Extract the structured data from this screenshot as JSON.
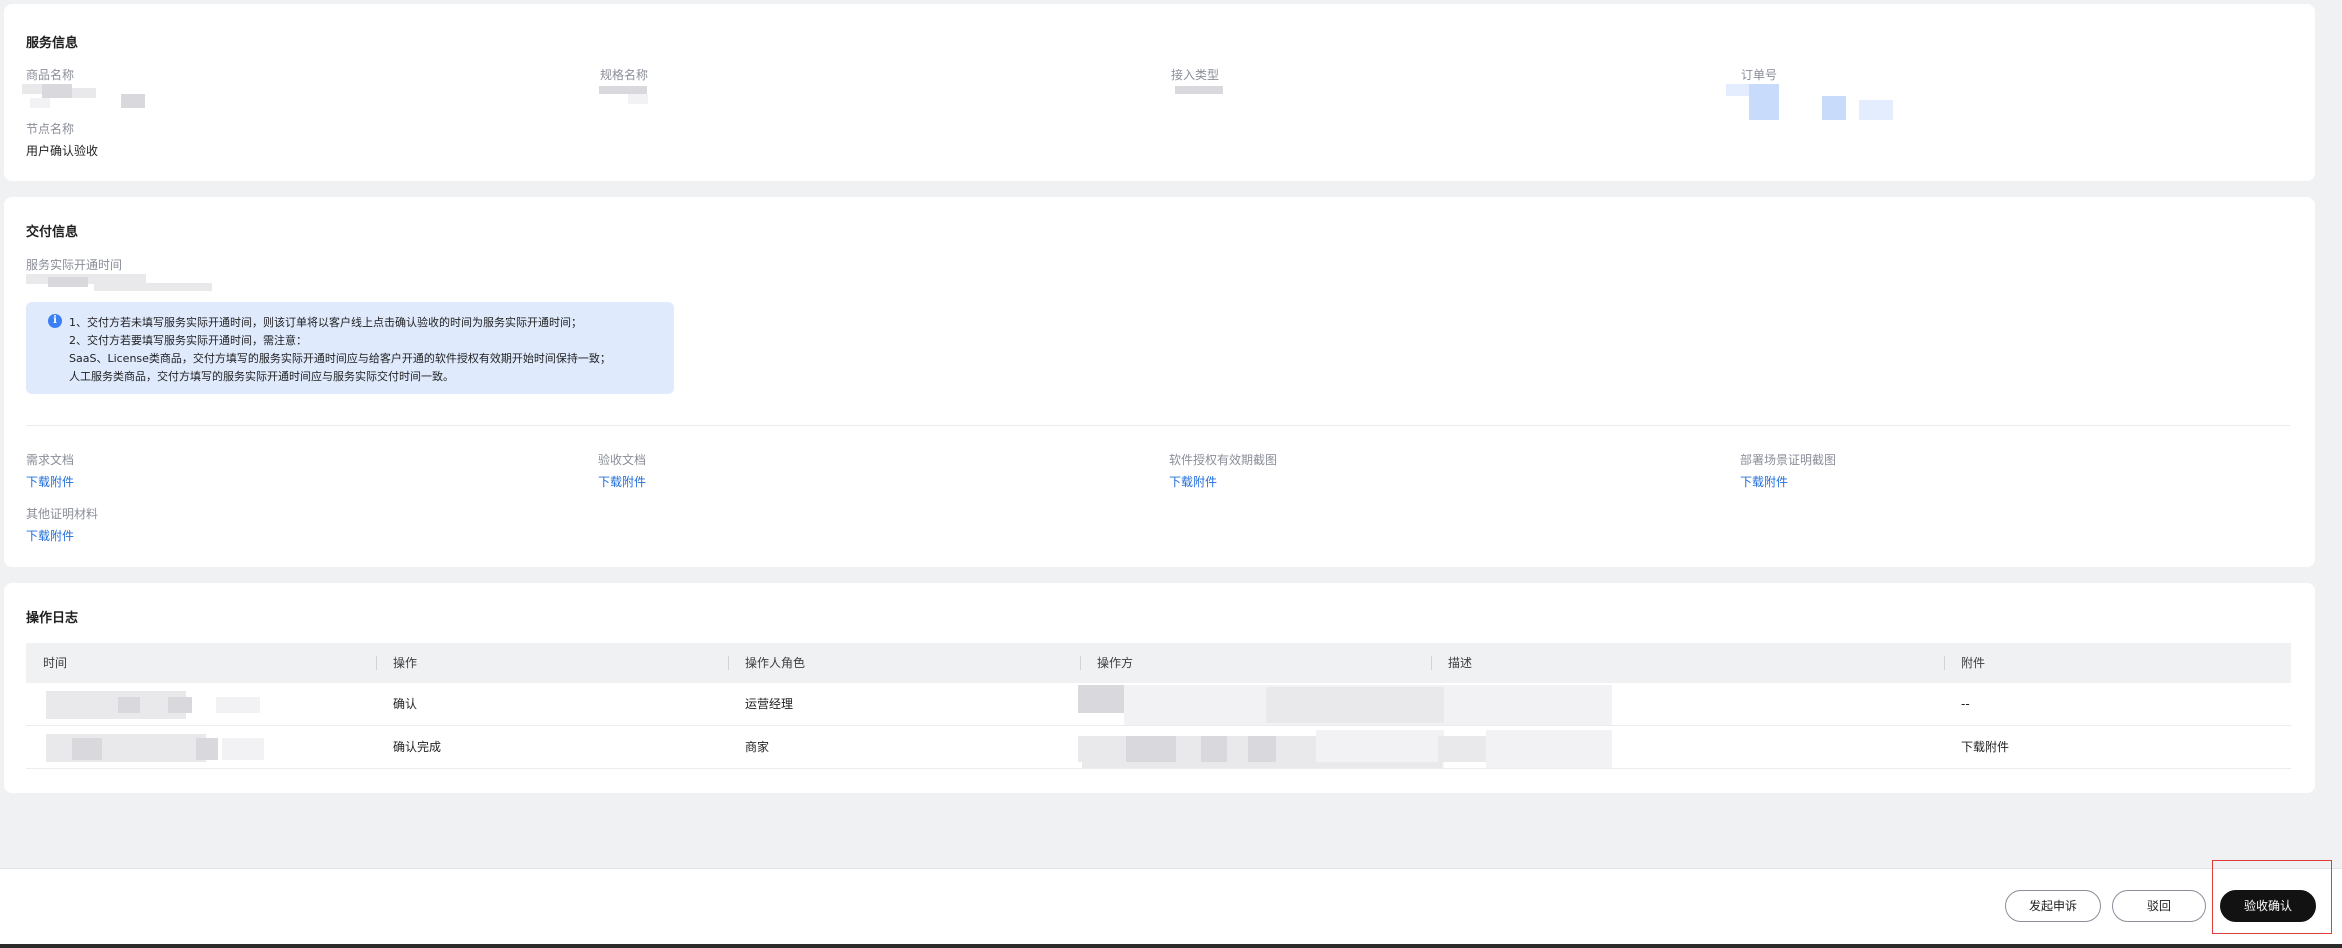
{
  "service_info": {
    "title": "服务信息",
    "product_name_label": "商品名称",
    "spec_name_label": "规格名称",
    "access_type_label": "接入类型",
    "order_no_label": "订单号",
    "node_name_label": "节点名称",
    "node_name_value": "用户确认验收"
  },
  "delivery_info": {
    "title": "交付信息",
    "actual_time_label": "服务实际开通时间",
    "notice_icon": "info-icon",
    "notice_lines": [
      "1、交付方若未填写服务实际开通时间，则该订单将以客户线上点击确认验收的时间为服务实际开通时间；",
      "2、交付方若要填写服务实际开通时间，需注意：",
      "SaaS、License类商品，交付方填写的服务实际开通时间应与给客户开通的软件授权有效期开始时间保持一致；",
      "人工服务类商品，交付方填写的服务实际开通时间应与服务实际交付时间一致。"
    ],
    "attachments": [
      {
        "label": "需求文档",
        "link": "下载附件"
      },
      {
        "label": "验收文档",
        "link": "下载附件"
      },
      {
        "label": "软件授权有效期截图",
        "link": "下载附件"
      },
      {
        "label": "部署场景证明截图",
        "link": "下载附件"
      },
      {
        "label": "其他证明材料",
        "link": "下载附件"
      }
    ]
  },
  "operation_log": {
    "title": "操作日志",
    "columns": [
      "时间",
      "操作",
      "操作人角色",
      "操作方",
      "描述",
      "附件"
    ],
    "rows": [
      {
        "action": "确认",
        "role": "运营经理",
        "attachment": "--"
      },
      {
        "action": "确认完成",
        "role": "商家",
        "attachment": "下载附件"
      }
    ]
  },
  "footer": {
    "appeal_label": "发起申诉",
    "reject_label": "驳回",
    "confirm_label": "验收确认"
  },
  "colors": {
    "accent_link": "#1f6ddb",
    "primary_button": "#121212",
    "notice_bg": "#dfeafd",
    "highlight_border": "#e03c3c"
  }
}
